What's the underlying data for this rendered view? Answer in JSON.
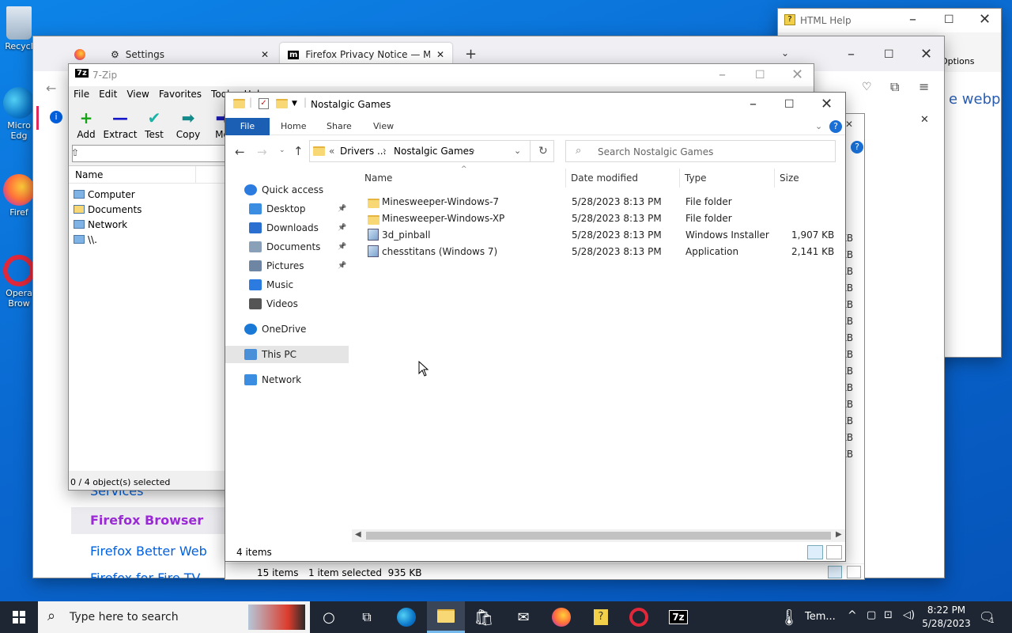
{
  "desktop": {
    "icons": [
      {
        "label": "Recycl"
      },
      {
        "label": "Micro Edg"
      },
      {
        "label": "Firef"
      },
      {
        "label": "Opera Brow"
      }
    ]
  },
  "htmlhelp": {
    "title": "HTML Help",
    "options": "Options",
    "partial": "e webp"
  },
  "firefox": {
    "tabs": [
      {
        "label": "Settings"
      },
      {
        "label": "Firefox Privacy Notice — Mozil"
      }
    ],
    "links": [
      "Services",
      "Firefox Browser",
      "Firefox Better Web",
      "Firefox for Fire TV"
    ],
    "status": {
      "items": "15 items",
      "selected": "1 item selected  935 KB"
    },
    "kb_column": [
      "KB",
      "KB",
      "KB",
      "KB",
      "KB",
      "KB",
      "KB",
      "KB",
      "KB",
      "KB",
      "KB",
      "KB",
      "KB",
      "KB"
    ]
  },
  "sevenzip": {
    "title": "7-Zip",
    "menu": [
      "File",
      "Edit",
      "View",
      "Favorites",
      "Tools",
      "Help"
    ],
    "tools": [
      {
        "label": "Add",
        "glyph": "+",
        "color": "#14a314"
      },
      {
        "label": "Extract",
        "glyph": "—",
        "color": "#1414c8"
      },
      {
        "label": "Test",
        "glyph": "✔",
        "color": "#18b4a8"
      },
      {
        "label": "Copy",
        "glyph": "➡",
        "color": "#138a8a"
      },
      {
        "label": "Mo",
        "glyph": "➡",
        "color": "#1b1bb0"
      }
    ],
    "header": "Name",
    "items": [
      "Computer",
      "Documents",
      "Network",
      "\\\\."
    ],
    "status": "0 / 4 object(s) selected"
  },
  "explorer": {
    "title": "Nostalgic Games",
    "ribbon": {
      "file": "File",
      "tabs": [
        "Home",
        "Share",
        "View"
      ]
    },
    "breadcrumb": {
      "prefix": "«",
      "parent": "Drivers ...",
      "current": "Nostalgic Games"
    },
    "search_placeholder": "Search Nostalgic Games",
    "nav": [
      {
        "label": "Quick access",
        "pinned": false
      },
      {
        "label": "Desktop",
        "pinned": true
      },
      {
        "label": "Downloads",
        "pinned": true
      },
      {
        "label": "Documents",
        "pinned": true
      },
      {
        "label": "Pictures",
        "pinned": true
      },
      {
        "label": "Music",
        "pinned": false
      },
      {
        "label": "Videos",
        "pinned": false
      },
      {
        "label": "OneDrive",
        "pinned": false
      },
      {
        "label": "This PC",
        "pinned": false
      },
      {
        "label": "Network",
        "pinned": false
      }
    ],
    "columns": {
      "name": "Name",
      "date": "Date modified",
      "type": "Type",
      "size": "Size"
    },
    "files": [
      {
        "name": "Minesweeper-Windows-7",
        "date": "5/28/2023 8:13 PM",
        "type": "File folder",
        "size": "",
        "kind": "folder"
      },
      {
        "name": "Minesweeper-Windows-XP",
        "date": "5/28/2023 8:13 PM",
        "type": "File folder",
        "size": "",
        "kind": "folder"
      },
      {
        "name": "3d_pinball",
        "date": "5/28/2023 8:13 PM",
        "type": "Windows Installer ...",
        "size": "1,907 KB",
        "kind": "installer"
      },
      {
        "name": "chesstitans (Windows 7)",
        "date": "5/28/2023 8:13 PM",
        "type": "Application",
        "size": "2,141 KB",
        "kind": "app"
      }
    ],
    "status": "4 items"
  },
  "taskbar": {
    "search_placeholder": "Type here to search",
    "tray_label": "Tem...",
    "time": "8:22 PM",
    "date": "5/28/2023",
    "notifications": "1"
  }
}
